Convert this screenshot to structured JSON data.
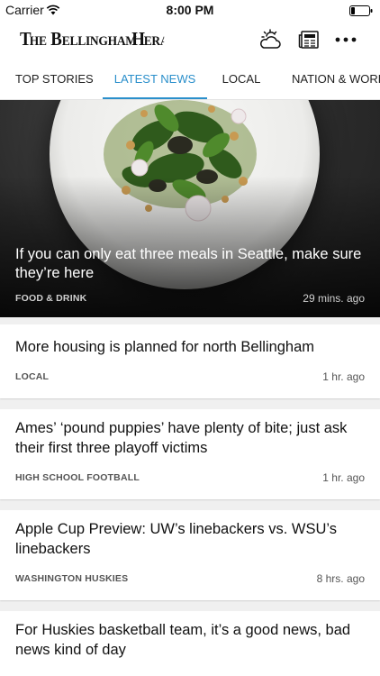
{
  "status_bar": {
    "carrier": "Carrier",
    "time": "8:00 PM"
  },
  "header": {
    "masthead": "The Bellingham Herald",
    "icons": [
      "weather-icon",
      "newspaper-icon",
      "more-icon"
    ]
  },
  "tabs": [
    {
      "label": "TOP STORIES",
      "active": false
    },
    {
      "label": "LATEST NEWS",
      "active": true
    },
    {
      "label": "LOCAL",
      "active": false
    },
    {
      "label": "NATION & WORLD",
      "active": false
    }
  ],
  "hero": {
    "title": "If you can only eat three meals in Seattle, make sure they’re here",
    "section": "FOOD & DRINK",
    "time": "29 mins. ago"
  },
  "articles": [
    {
      "title": "More housing is planned for north Bellingham",
      "section": "LOCAL",
      "time": "1 hr. ago"
    },
    {
      "title": "Ames’ ‘pound puppies’ have plenty of bite; just ask their first three playoff victims",
      "section": "HIGH SCHOOL FOOTBALL",
      "time": "1 hr. ago"
    },
    {
      "title": "Apple Cup Preview: UW’s linebackers vs. WSU’s linebackers",
      "section": "WASHINGTON HUSKIES",
      "time": "8 hrs. ago"
    },
    {
      "title": "For Huskies basketball team, it’s a good news, bad news kind of day",
      "section": "",
      "time": ""
    }
  ],
  "colors": {
    "accent": "#2a8fcb"
  }
}
